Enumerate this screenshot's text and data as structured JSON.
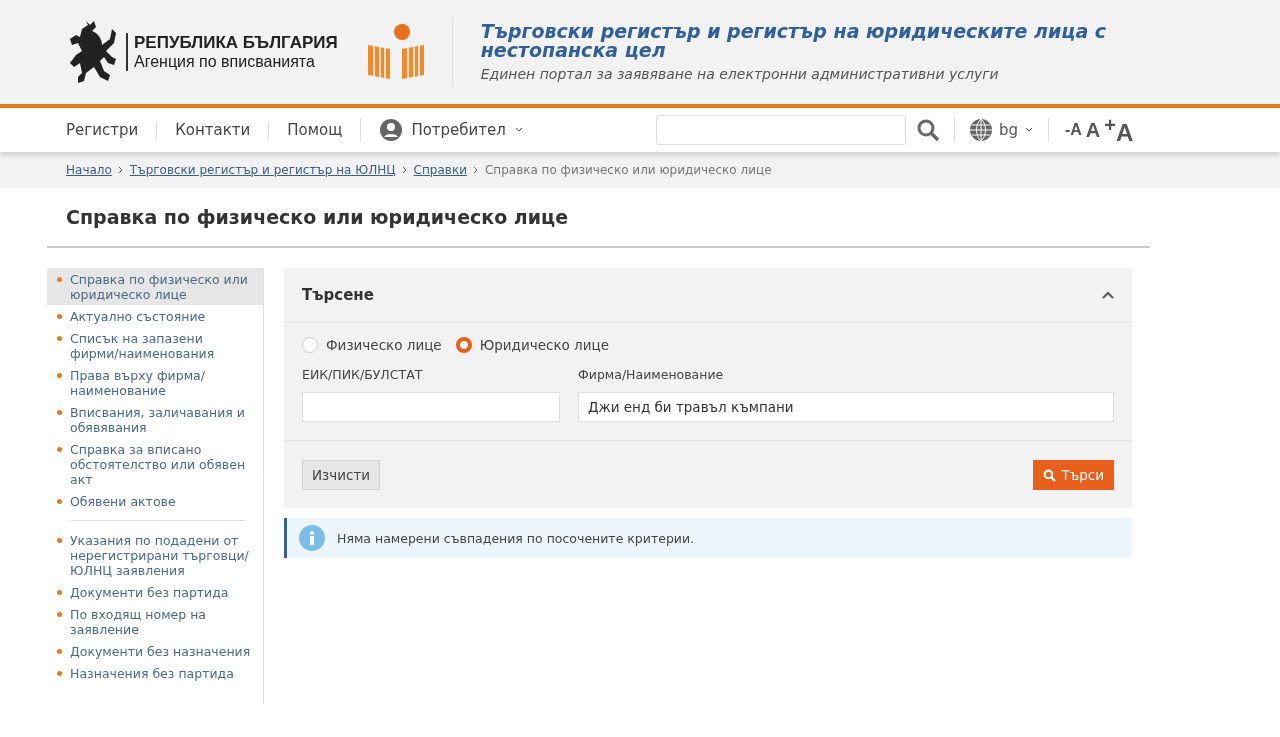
{
  "header": {
    "org_line1": "РЕПУБЛИКА БЪЛГАРИЯ",
    "org_line2": "Агенция по вписванията",
    "title": "Търговски регистър и регистър на юридическите лица с нестопанска цел",
    "subtitle": "Единен портал за заявяване на електронни административни услуги"
  },
  "nav": {
    "items": [
      "Регистри",
      "Контакти",
      "Помощ"
    ],
    "user": "Потребител",
    "language": "bg",
    "font_sizes": [
      "-A",
      "A",
      "$^{+}$A"
    ]
  },
  "breadcrumb": [
    {
      "label": "Начало",
      "link": true
    },
    {
      "label": "Търговски регистър и регистър на ЮЛНЦ",
      "link": true
    },
    {
      "label": "Справки",
      "link": true
    },
    {
      "label": "Справка по физическо или юридическо лице",
      "link": false
    }
  ],
  "page_title": "Справка по физическо или юридическо лице",
  "sidebar": {
    "groups": [
      [
        {
          "label": "Справка по физическо или юридическо лице",
          "selected": true
        },
        {
          "label": "Актуално състояние",
          "selected": false
        },
        {
          "label": "Списък на запазени фирми/наименования",
          "selected": false
        },
        {
          "label": "Права върху фирма/ наименование",
          "selected": false
        },
        {
          "label": "Вписвания, заличавания и обявявания",
          "selected": false
        },
        {
          "label": "Справка за вписано обстоятелство или обявен акт",
          "selected": false
        },
        {
          "label": "Обявени актове",
          "selected": false
        }
      ],
      [
        {
          "label": "Указания по подадени от нерегистрирани търговци/ ЮЛНЦ заявления",
          "selected": false
        },
        {
          "label": "Документи без партида",
          "selected": false
        },
        {
          "label": "По входящ номер на заявление",
          "selected": false
        },
        {
          "label": "Документи без назначения",
          "selected": false
        },
        {
          "label": "Назначения без партида",
          "selected": false
        }
      ]
    ]
  },
  "search_panel": {
    "title": "Търсене",
    "expanded": true,
    "radios": [
      {
        "label": "Физическо лице",
        "selected": false
      },
      {
        "label": "Юридическо лице",
        "selected": true
      }
    ],
    "fields": [
      {
        "label": "ЕИК/ПИК/БУЛСТАТ"
      },
      {
        "label": "Фирма/Наименование",
        "value": "Джи енд би травъл къмпани"
      }
    ],
    "clear_button": "Изчисти",
    "search_button": "Търси"
  },
  "alert": "Няма намерени съвпадения по посочените критерии."
}
